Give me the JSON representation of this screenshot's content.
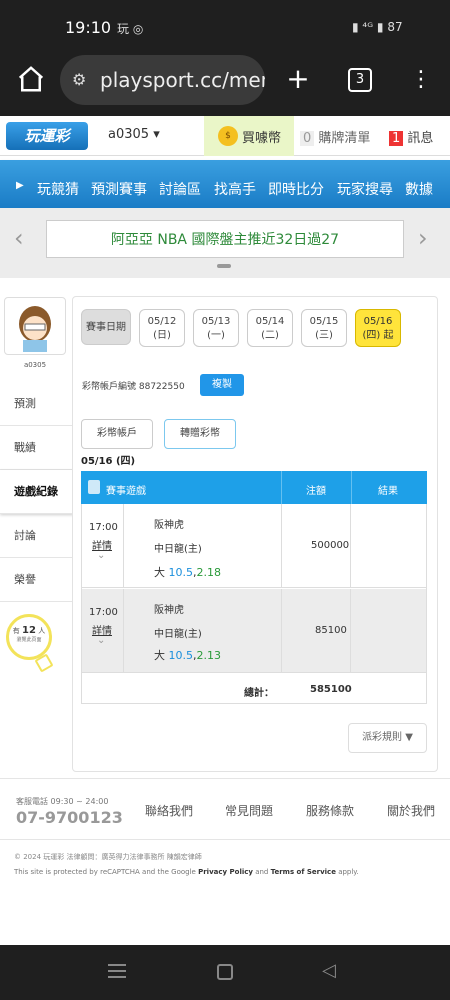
{
  "status": {
    "time": "19:10",
    "icons_left": "玩 ◎",
    "icons_right": "▮ ⁴ᴳ ▮ 87"
  },
  "browser": {
    "url": "playsport.cc/men",
    "tab_count": "3"
  },
  "site": {
    "logo": "玩運彩",
    "username": "a0305",
    "buy_coins": "買噱幣",
    "cart_count": "0",
    "cart_label": "購牌清單",
    "msg_count": "1",
    "msg_label": "訊息"
  },
  "nav": [
    "玩競猜",
    "預測賽事",
    "討論區",
    "找高手",
    "即時比分",
    "玩家搜尋",
    "數據"
  ],
  "promo": "阿亞亞 NBA 國際盤主推近32日過27",
  "profile": {
    "name": "a0305"
  },
  "sidenav": [
    "預測",
    "戰績",
    "遊戲紀錄",
    "討論",
    "榮譽"
  ],
  "online": {
    "prefix": "有",
    "count": "12",
    "suffix": "人",
    "line2": "瀏覽此頁面"
  },
  "dates": {
    "label": "賽事日期",
    "items": [
      {
        "d": "05/12",
        "w": "(日)"
      },
      {
        "d": "05/13",
        "w": "(一)"
      },
      {
        "d": "05/14",
        "w": "(二)"
      },
      {
        "d": "05/15",
        "w": "(三)"
      },
      {
        "d": "05/16",
        "w": "(四) 起"
      }
    ]
  },
  "account": {
    "label": "彩幣帳戶編號 88722550",
    "copy": "複製"
  },
  "buttons": {
    "account": "彩幣帳戶",
    "transfer": "轉贈彩幣"
  },
  "date_heading": "05/16 (四)",
  "table": {
    "headers": [
      "賽事遊戲",
      "注額",
      "結果"
    ],
    "rows": [
      {
        "time": "17:00",
        "detail": "詳情",
        "team1": "阪神虎",
        "team2": "中日龍(主)",
        "bet_prefix": "大",
        "line": "10.5",
        "odds": "2.18",
        "amount": "500000",
        "result": ""
      },
      {
        "time": "17:00",
        "detail": "詳情",
        "team1": "阪神虎",
        "team2": "中日龍(主)",
        "bet_prefix": "大",
        "line": "10.5",
        "odds": "2.13",
        "amount": "85100",
        "result": ""
      }
    ],
    "total_label": "總計：",
    "total": "585100"
  },
  "rules": "派彩規則 ▼",
  "footer": {
    "service_label": "客服電話 09:30 ~ 24:00",
    "phone": "07-9700123",
    "links": [
      "聯絡我們",
      "常見問題",
      "服務條款",
      "關於我們"
    ],
    "copyright": "© 2024 玩運彩 法律顧問：廣英得力法律事務所 陳韻宏律師",
    "recaptcha_pre": "This site is protected by reCAPTCHA and the Google",
    "privacy": "Privacy Policy",
    "and": "and",
    "terms": "Terms of Service",
    "apply": "apply."
  }
}
